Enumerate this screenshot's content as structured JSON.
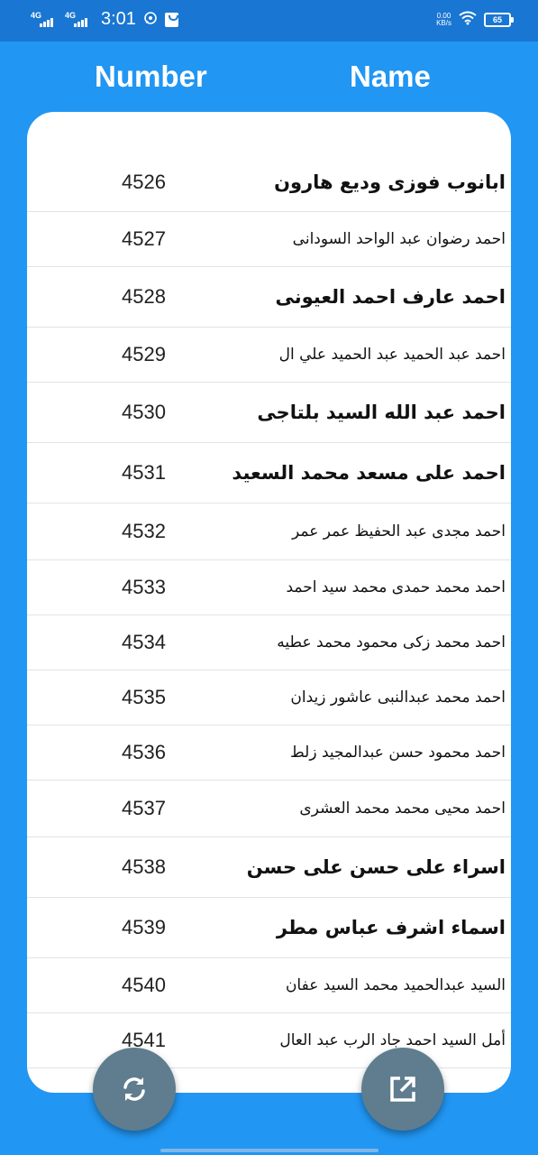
{
  "status_bar": {
    "network_1": "4G",
    "network_2": "4G",
    "time": "3:01",
    "speed_value": "0.00",
    "speed_unit": "KB/s",
    "battery": "65",
    "icons": [
      "signal-icon",
      "whatsapp-icon",
      "bag-icon",
      "wifi-icon",
      "battery-icon"
    ]
  },
  "header": {
    "number_label": "Number",
    "name_label": "Name"
  },
  "rows": [
    {
      "number": "4526",
      "name": "ابانوب فوزى وديع هارون"
    },
    {
      "number": "4527",
      "name": "احمد رضوان عبد الواحد السودانى"
    },
    {
      "number": "4528",
      "name": "احمد عارف احمد العيونى"
    },
    {
      "number": "4529",
      "name": "احمد عبد الحميد عبد الحميد علي ال"
    },
    {
      "number": "4530",
      "name": "احمد عبد الله السيد بلتاجى"
    },
    {
      "number": "4531",
      "name": "احمد على مسعد محمد السعيد"
    },
    {
      "number": "4532",
      "name": "احمد مجدى عبد الحفيظ عمر عمر"
    },
    {
      "number": "4533",
      "name": "احمد محمد حمدى محمد سيد احمد"
    },
    {
      "number": "4534",
      "name": "احمد محمد زكى محمود محمد عطيه"
    },
    {
      "number": "4535",
      "name": "احمد محمد عبدالنبى عاشور زيدان"
    },
    {
      "number": "4536",
      "name": "احمد محمود حسن عبدالمجيد زلط"
    },
    {
      "number": "4537",
      "name": "احمد محيى محمد محمد العشرى"
    },
    {
      "number": "4538",
      "name": "اسراء على حسن على حسن"
    },
    {
      "number": "4539",
      "name": "اسماء اشرف عباس مطر"
    },
    {
      "number": "4540",
      "name": "السيد عبدالحميد محمد السيد عفان"
    },
    {
      "number": "4541",
      "name": "أمل السيد احمد جاد الرب عبد العال"
    }
  ],
  "fabs": {
    "refresh_icon": "refresh-icon",
    "open_icon": "open-in-new-icon"
  },
  "colors": {
    "background": "#2196F3",
    "status_bar": "#1976D2",
    "card": "#FFFFFF",
    "fab": "#5F7D8E"
  }
}
